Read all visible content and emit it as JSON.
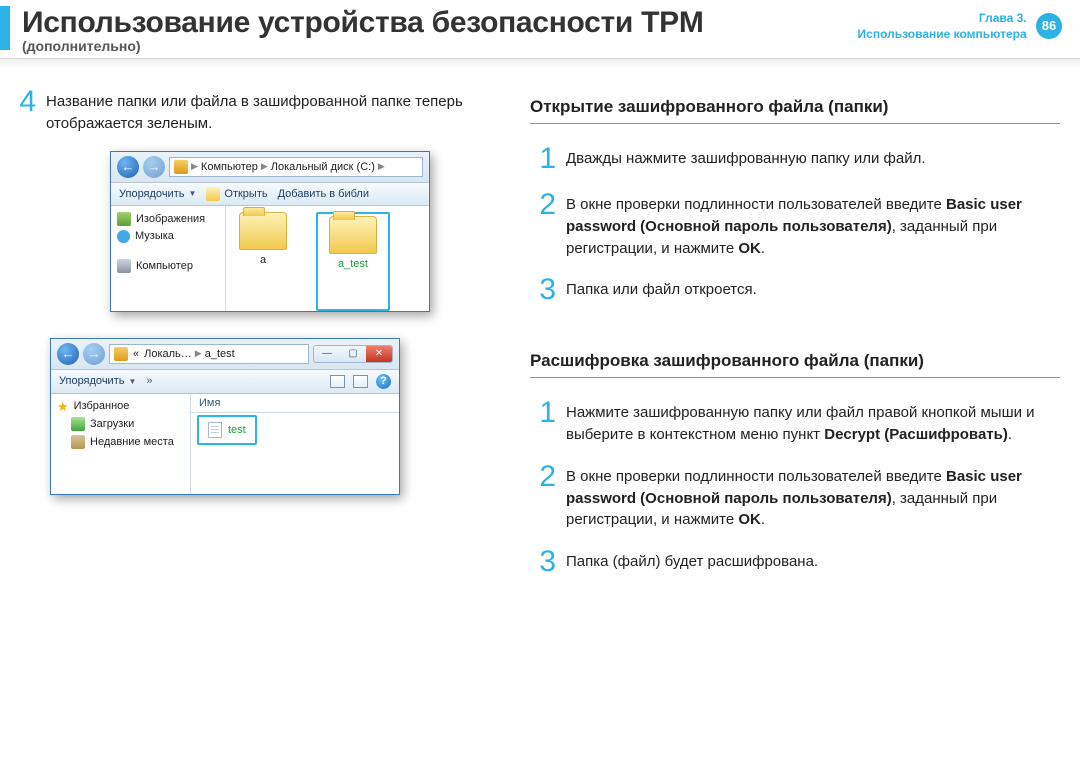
{
  "header": {
    "title": "Использование устройства безопасности TPM",
    "subtitle": "(дополнительно)",
    "chapter_line1": "Глава 3.",
    "chapter_line2": "Использование компьютера",
    "page_number": "86"
  },
  "left": {
    "step4_num": "4",
    "step4_text": "Название папки или файла в зашифрованной папке теперь отображается зеленым.",
    "explorer1": {
      "bc_computer": "Компьютер",
      "bc_disk": "Локальный диск (C:)",
      "tb_organize": "Упорядочить",
      "tb_open": "Открыть",
      "tb_addlib": "Добавить в библи",
      "tree_images": "Изображения",
      "tree_music": "Музыка",
      "tree_computer": "Компьютер",
      "folder_a": "a",
      "folder_atest": "a_test"
    },
    "explorer2": {
      "bc_local": "Локаль…",
      "bc_atest": "a_test",
      "tb_organize": "Упорядочить",
      "list_header": "Имя",
      "tree_fav": "Избранное",
      "tree_dl": "Загрузки",
      "tree_recent": "Недавние места",
      "file_test": "test"
    }
  },
  "right": {
    "sec1_heading": "Открытие зашифрованного файла (папки)",
    "s1": {
      "num": "1",
      "text": "Дважды нажмите зашифрованную папку или файл."
    },
    "s2": {
      "num": "2",
      "t1": "В окне проверки подлинности пользователей введите ",
      "b1": "Basic user password (Основной пароль пользователя)",
      "t2": ", заданный при регистрации, и нажмите ",
      "b2": "OK",
      "t3": "."
    },
    "s3": {
      "num": "3",
      "text": "Папка или файл откроется."
    },
    "sec2_heading": "Расшифровка зашифрованного файла (папки)",
    "d1": {
      "num": "1",
      "t1": "Нажмите зашифрованную папку или файл правой кнопкой мыши и выберите в контекстном меню пункт ",
      "b1": "Decrypt (Расшифровать)",
      "t2": "."
    },
    "d2": {
      "num": "2",
      "t1": "В окне проверки подлинности пользователей введите ",
      "b1": "Basic user password (Основной пароль пользователя)",
      "t2": ", заданный при регистрации, и нажмите ",
      "b2": "OK",
      "t3": "."
    },
    "d3": {
      "num": "3",
      "text": "Папка (файл) будет расшифрована."
    }
  }
}
